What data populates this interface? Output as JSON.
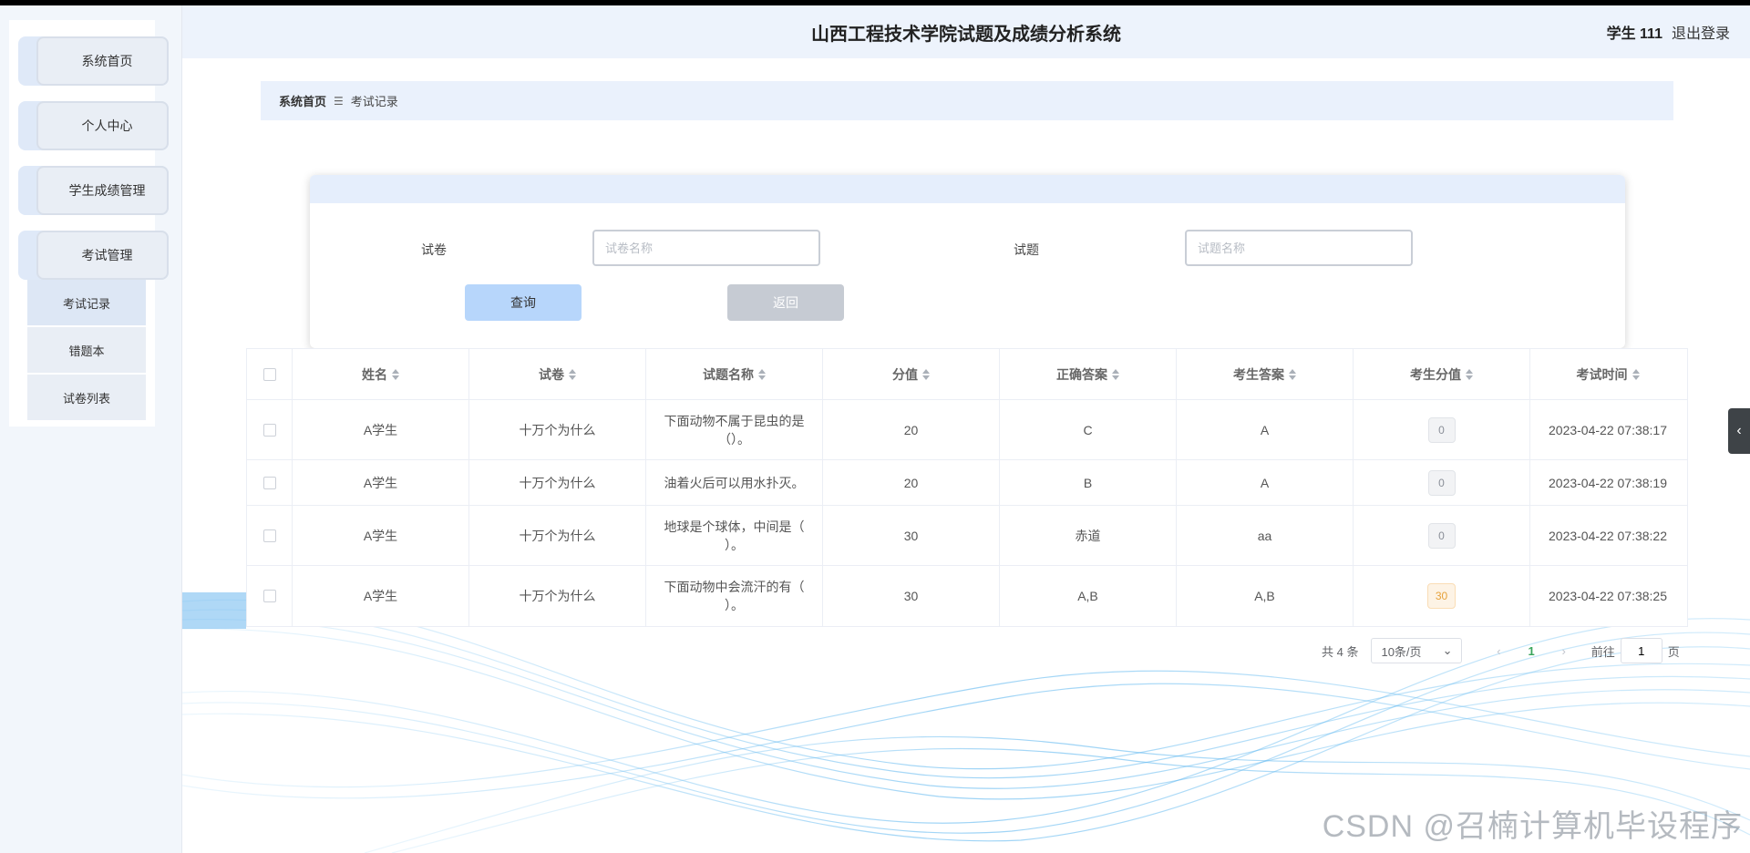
{
  "app": {
    "title": "山西工程技术学院试题及成绩分析系统",
    "user": "学生 111",
    "logout": "退出登录"
  },
  "sidebar": {
    "items": [
      {
        "label": "系统首页"
      },
      {
        "label": "个人中心"
      },
      {
        "label": "学生成绩管理"
      },
      {
        "label": "考试管理"
      }
    ],
    "submenu": [
      {
        "label": "考试记录"
      },
      {
        "label": "错题本"
      },
      {
        "label": "试卷列表"
      }
    ]
  },
  "breadcrumb": {
    "home": "系统首页",
    "sep": "☰",
    "current": "考试记录"
  },
  "search": {
    "paper_label": "试卷",
    "paper_placeholder": "试卷名称",
    "question_label": "试题",
    "question_placeholder": "试题名称",
    "query_button": "查询",
    "back_button": "返回"
  },
  "table": {
    "headers": [
      "姓名",
      "试卷",
      "试题名称",
      "分值",
      "正确答案",
      "考生答案",
      "考生分值",
      "考试时间"
    ],
    "rows": [
      {
        "name": "A学生",
        "paper": "十万个为什么",
        "question": "下面动物不属于昆虫的是（）。",
        "value": "20",
        "correct": "C",
        "answer": "A",
        "score": "0",
        "time": "2023-04-22 07:38:17"
      },
      {
        "name": "A学生",
        "paper": "十万个为什么",
        "question": "油着火后可以用水扑灭。",
        "value": "20",
        "correct": "B",
        "answer": "A",
        "score": "0",
        "time": "2023-04-22 07:38:19"
      },
      {
        "name": "A学生",
        "paper": "十万个为什么",
        "question": "地球是个球体，中间是（ ）。",
        "value": "30",
        "correct": "赤道",
        "answer": "aa",
        "score": "0",
        "time": "2023-04-22 07:38:22"
      },
      {
        "name": "A学生",
        "paper": "十万个为什么",
        "question": "下面动物中会流汗的有（ ）。",
        "value": "30",
        "correct": "A,B",
        "answer": "A,B",
        "score": "30",
        "time": "2023-04-22 07:38:25"
      }
    ]
  },
  "pagination": {
    "total": "共 4 条",
    "page_size": "10条/页",
    "current_page": "1",
    "goto_prefix": "前往",
    "goto_value": "1",
    "goto_suffix": "页"
  },
  "watermark": "CSDN @召楠计算机毕设程序",
  "colors": {
    "accent_page": "#3aa55c",
    "query_button": "#b7d6fb",
    "back_button": "#c6cbd3",
    "warn_badge": "#e6a23c"
  }
}
